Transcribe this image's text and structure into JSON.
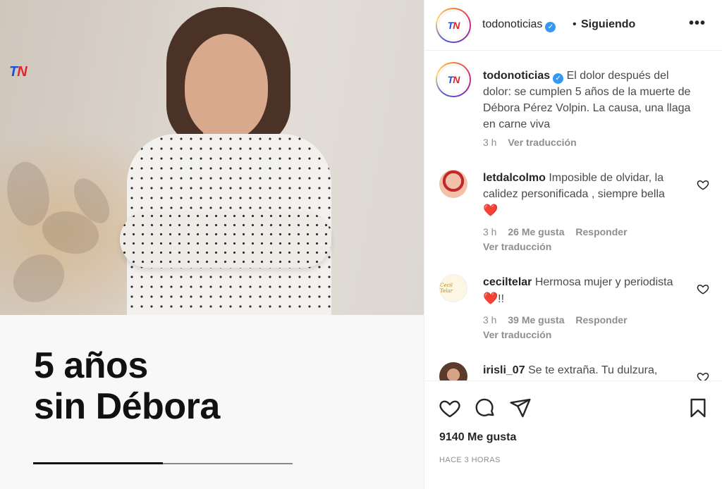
{
  "media": {
    "logo": {
      "t": "T",
      "n": "N"
    },
    "headline_line1": "5 años",
    "headline_line2": "sin Débora",
    "progress": 0.5
  },
  "header": {
    "avatar_t": "T",
    "avatar_n": "N",
    "username": "todonoticias",
    "separator": "•",
    "follow_label": "Siguiendo",
    "more_label": "•••"
  },
  "caption": {
    "username": "todonoticias",
    "text": "El dolor después del dolor: se cumplen 5 años de la muerte de Débora Pérez Volpin. La causa, una llaga en carne viva",
    "time": "3 h",
    "translate": "Ver traducción"
  },
  "comments": [
    {
      "username": "letdalcolmo",
      "text": "Imposible de olvidar, la calidez personificada , siempre bella",
      "emoji": "❤️",
      "time": "3 h",
      "likes": "26 Me gusta",
      "reply": "Responder",
      "translate": "Ver traducción"
    },
    {
      "username": "ceciltelar",
      "text": "Hermosa mujer y periodista",
      "emoji": "❤️",
      "suffix": "!!",
      "time": "3 h",
      "likes": "39 Me gusta",
      "reply": "Responder",
      "translate": "Ver traducción",
      "avatar_text": "Cecil Telar"
    },
    {
      "username": "irisli_07",
      "text": "Se te extraña. Tu dulzura,"
    }
  ],
  "footer": {
    "likes": "9140 Me gusta",
    "time_ago": "HACE 3 HORAS"
  },
  "icons": {
    "like": "heart-icon",
    "comment": "comment-icon",
    "share": "share-icon",
    "save": "bookmark-icon"
  }
}
